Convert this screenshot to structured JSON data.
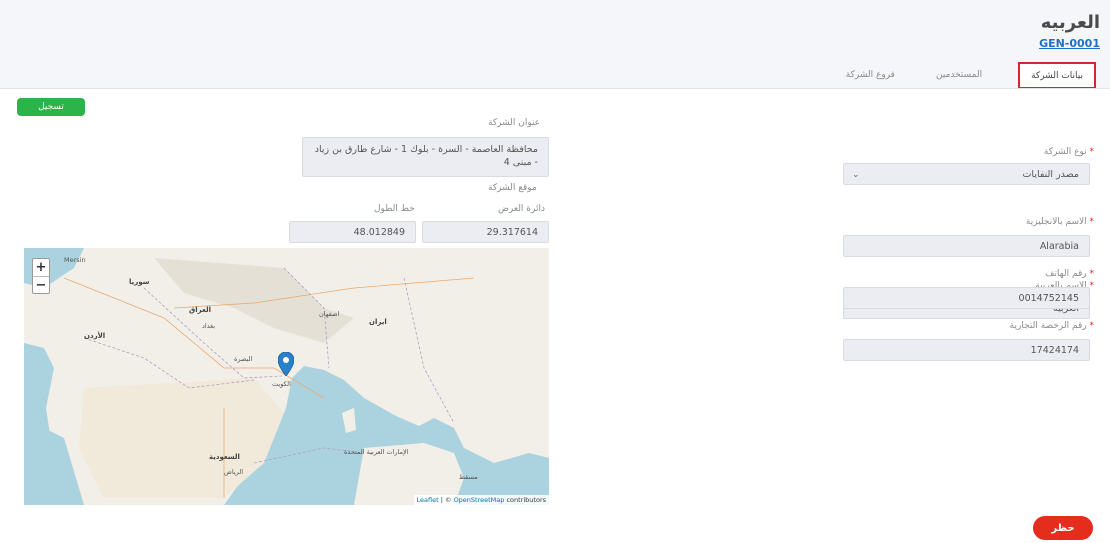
{
  "header": {
    "title": "العربيه",
    "code": "GEN-0001"
  },
  "tabs": [
    {
      "label": "بيانات الشركة",
      "active": true
    },
    {
      "label": "المستخدمين",
      "active": false
    },
    {
      "label": "فروع الشركة",
      "active": false
    }
  ],
  "form": {
    "company_type": {
      "label": "نوع الشركة",
      "value": "مصدر النفايات"
    },
    "name_ar": {
      "label": "الاسم بالعربية",
      "value": "العربيه"
    },
    "name_en": {
      "label": "الاسم بالانجليزية",
      "value": "Alarabia"
    },
    "phone": {
      "label": "رقم الهاتف",
      "value": "0014752145"
    },
    "license": {
      "label": "رقم الرخصة التجارية",
      "value": "17424174"
    },
    "address": {
      "label": "عنوان الشركة",
      "value": "محافظة العاصمة - السرة - بلوك 1 - شارع طارق بن زياد - مبنى 4"
    },
    "location": {
      "label": "موقع الشركة"
    },
    "latitude": {
      "label": "دائرة العرض",
      "value": "29.317614"
    },
    "longitude": {
      "label": "خط الطول",
      "value": "48.012849"
    },
    "required_mark": "*"
  },
  "buttons": {
    "register": "تسجيل",
    "ban": "حظر"
  },
  "map": {
    "zoom_in": "+",
    "zoom_out": "−",
    "attribution": {
      "leaflet": "Leaflet",
      "sep": " | © ",
      "osm": "OpenStreetMap",
      "tail": " contributors"
    },
    "labels": {
      "iraq": "العراق",
      "iran": "ایران",
      "saudi": "السعودية",
      "syria": "سوريا",
      "jordan": "الأردن",
      "kuwait": "الكويت",
      "riyadh": "الرياض",
      "uae": "الإمارات العربية المتحدة",
      "muscat": "مسقط",
      "isfahan": "اصفهان",
      "baghdad": "بغداد",
      "basra": "البصرة",
      "mersin": "Mersin"
    }
  },
  "colors": {
    "accent_blue": "#1f6fc9",
    "green": "#2cb34a",
    "red": "#e52d1e",
    "tab_highlight": "#d9232d"
  }
}
